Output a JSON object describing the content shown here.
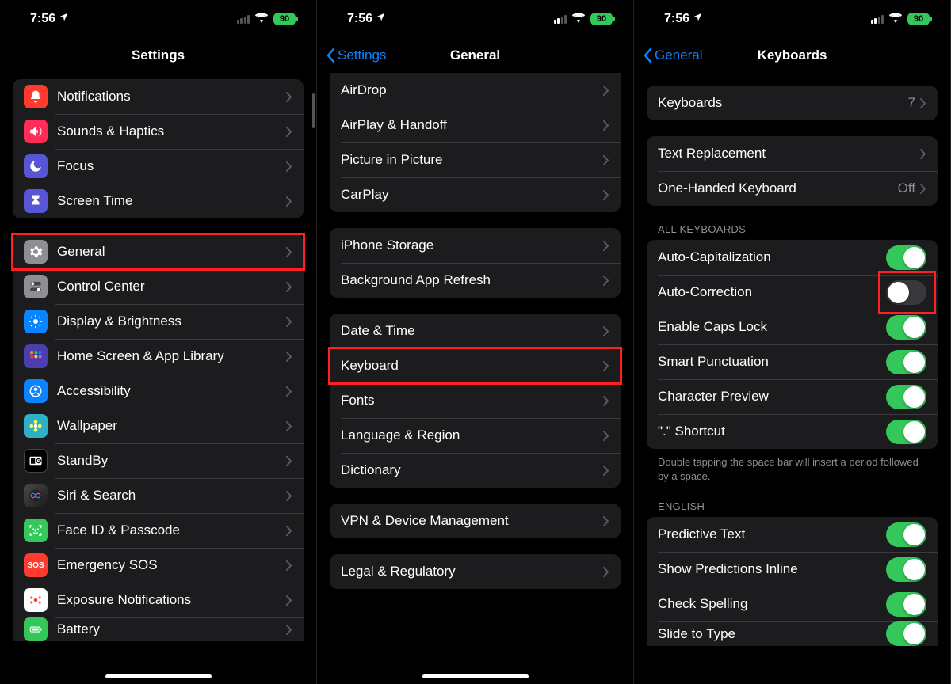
{
  "status": {
    "time": "7:56",
    "battery": "90"
  },
  "phone1": {
    "title": "Settings",
    "groups": [
      {
        "rows": [
          {
            "key": "notifications",
            "label": "Notifications",
            "iconBg": "#ff3b30",
            "icon": "bell"
          },
          {
            "key": "sounds",
            "label": "Sounds & Haptics",
            "iconBg": "#ff2d55",
            "icon": "speaker"
          },
          {
            "key": "focus",
            "label": "Focus",
            "iconBg": "#5856d6",
            "icon": "moon"
          },
          {
            "key": "screentime",
            "label": "Screen Time",
            "iconBg": "#5856d6",
            "icon": "hourglass"
          }
        ]
      },
      {
        "rows": [
          {
            "key": "general",
            "label": "General",
            "iconBg": "#8e8e93",
            "icon": "gear",
            "highlight": true
          },
          {
            "key": "controlcenter",
            "label": "Control Center",
            "iconBg": "#8e8e93",
            "icon": "switches"
          },
          {
            "key": "display",
            "label": "Display & Brightness",
            "iconBg": "#0a84ff",
            "icon": "sun"
          },
          {
            "key": "homescreen",
            "label": "Home Screen & App Library",
            "iconBg": "#4b3fae",
            "icon": "grid"
          },
          {
            "key": "accessibility",
            "label": "Accessibility",
            "iconBg": "#0a84ff",
            "icon": "person"
          },
          {
            "key": "wallpaper",
            "label": "Wallpaper",
            "iconBg": "#30b0c7",
            "icon": "flower"
          },
          {
            "key": "standby",
            "label": "StandBy",
            "iconBg": "#000",
            "icon": "clock",
            "iconBorder": true
          },
          {
            "key": "siri",
            "label": "Siri & Search",
            "iconBg": "grad",
            "icon": "siri"
          },
          {
            "key": "faceid",
            "label": "Face ID & Passcode",
            "iconBg": "#34c759",
            "icon": "faceid"
          },
          {
            "key": "sos",
            "label": "Emergency SOS",
            "iconBg": "#ff3b30",
            "icon": "sos"
          },
          {
            "key": "exposure",
            "label": "Exposure Notifications",
            "iconBg": "#fff",
            "icon": "exposure",
            "iconFg": "#ff3b30"
          },
          {
            "key": "battery",
            "label": "Battery",
            "iconBg": "#34c759",
            "icon": "battery",
            "cropped": true
          }
        ]
      }
    ]
  },
  "phone2": {
    "title": "General",
    "back": "Settings",
    "groups": [
      {
        "first": true,
        "rows": [
          {
            "key": "airdrop",
            "label": "AirDrop"
          },
          {
            "key": "airplay",
            "label": "AirPlay & Handoff"
          },
          {
            "key": "pip",
            "label": "Picture in Picture"
          },
          {
            "key": "carplay",
            "label": "CarPlay"
          }
        ]
      },
      {
        "rows": [
          {
            "key": "storage",
            "label": "iPhone Storage"
          },
          {
            "key": "bgrefresh",
            "label": "Background App Refresh"
          }
        ]
      },
      {
        "rows": [
          {
            "key": "datetime",
            "label": "Date & Time"
          },
          {
            "key": "keyboard",
            "label": "Keyboard",
            "highlight": true
          },
          {
            "key": "fonts",
            "label": "Fonts"
          },
          {
            "key": "langregion",
            "label": "Language & Region"
          },
          {
            "key": "dictionary",
            "label": "Dictionary"
          }
        ]
      },
      {
        "rows": [
          {
            "key": "vpn",
            "label": "VPN & Device Management"
          }
        ]
      },
      {
        "rows": [
          {
            "key": "legal",
            "label": "Legal & Regulatory"
          }
        ]
      }
    ]
  },
  "phone3": {
    "title": "Keyboards",
    "back": "General",
    "groups": [
      {
        "rows": [
          {
            "key": "keyboards",
            "label": "Keyboards",
            "value": "7"
          }
        ]
      },
      {
        "rows": [
          {
            "key": "textreplace",
            "label": "Text Replacement"
          },
          {
            "key": "onehanded",
            "label": "One-Handed Keyboard",
            "value": "Off"
          }
        ]
      }
    ],
    "allKeyboardsHeader": "All Keyboards",
    "allKeyboards": [
      {
        "key": "autocap",
        "label": "Auto-Capitalization",
        "on": true
      },
      {
        "key": "autocorrect",
        "label": "Auto-Correction",
        "on": false,
        "highlight": true
      },
      {
        "key": "capslock",
        "label": "Enable Caps Lock",
        "on": true
      },
      {
        "key": "smartpunct",
        "label": "Smart Punctuation",
        "on": true
      },
      {
        "key": "charpreview",
        "label": "Character Preview",
        "on": true
      },
      {
        "key": "shortcut",
        "label": "\".\" Shortcut",
        "on": true
      }
    ],
    "footer": "Double tapping the space bar will insert a period followed by a space.",
    "englishHeader": "English",
    "english": [
      {
        "key": "predictive",
        "label": "Predictive Text",
        "on": true
      },
      {
        "key": "showpred",
        "label": "Show Predictions Inline",
        "on": true
      },
      {
        "key": "spelling",
        "label": "Check Spelling",
        "on": true
      },
      {
        "key": "slide",
        "label": "Slide to Type",
        "on": true,
        "cropped": true
      }
    ]
  }
}
